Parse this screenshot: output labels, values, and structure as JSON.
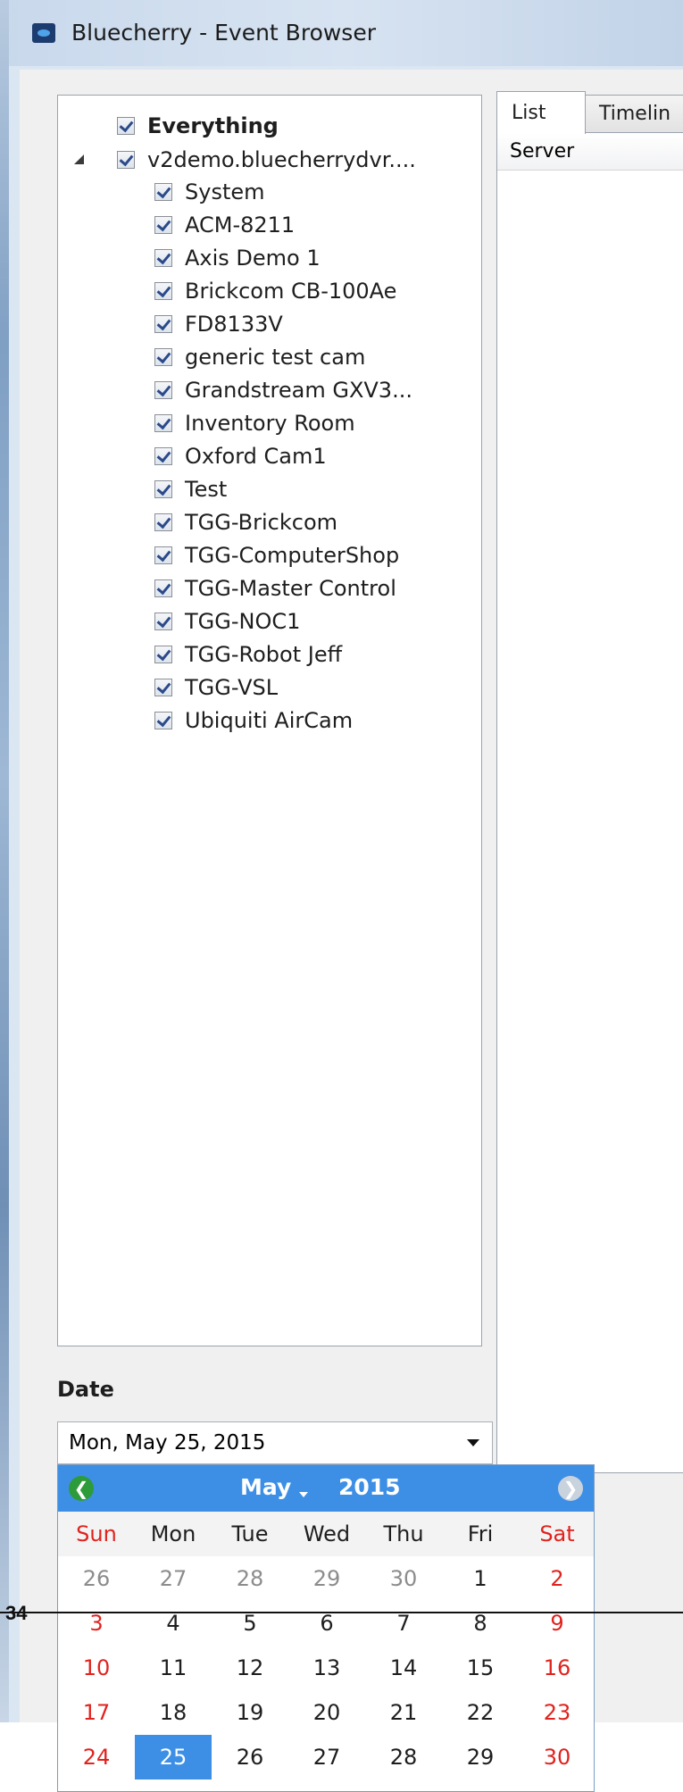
{
  "window": {
    "title": "Bluecherry - Event Browser"
  },
  "tree": {
    "root_label": "Everything",
    "server_label": "v2demo.bluecherrydvr....",
    "devices": [
      "System",
      "ACM-8211",
      "Axis Demo 1",
      "Brickcom CB-100Ae",
      "FD8133V",
      "generic test cam",
      "Grandstream GXV3...",
      "Inventory Room",
      "Oxford Cam1",
      "Test",
      "TGG-Brickcom",
      "TGG-ComputerShop",
      "TGG-Master Control",
      "TGG-NOC1",
      "TGG-Robot Jeff",
      "TGG-VSL",
      "Ubiquiti AirCam"
    ]
  },
  "tabs": {
    "list": "List",
    "timeline": "Timelin"
  },
  "list": {
    "column_server": "Server"
  },
  "date": {
    "label": "Date",
    "value": "Mon, May 25, 2015"
  },
  "calendar": {
    "month": "May",
    "year": "2015",
    "weekdays": [
      "Sun",
      "Mon",
      "Tue",
      "Wed",
      "Thu",
      "Fri",
      "Sat"
    ],
    "weeks": [
      [
        "26",
        "27",
        "28",
        "29",
        "30",
        "1",
        "2"
      ],
      [
        "3",
        "4",
        "5",
        "6",
        "7",
        "8",
        "9"
      ],
      [
        "10",
        "11",
        "12",
        "13",
        "14",
        "15",
        "16"
      ],
      [
        "17",
        "18",
        "19",
        "20",
        "21",
        "22",
        "23"
      ],
      [
        "24",
        "25",
        "26",
        "27",
        "28",
        "29",
        "30"
      ]
    ],
    "selected_day": "25",
    "colors": {
      "header": "#3d8fe6",
      "weekend": "#e0231e",
      "other_month": "#8c8c8c"
    }
  },
  "page_marker": "34"
}
